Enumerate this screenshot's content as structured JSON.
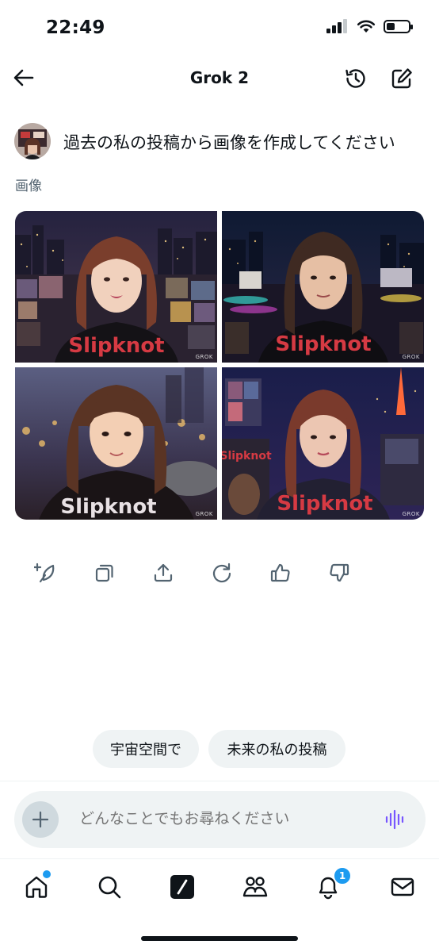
{
  "status_bar": {
    "time": "22:49",
    "battery_level": 0.4
  },
  "header": {
    "title": "Grok 2"
  },
  "conversation": {
    "prompt": "過去の私の投稿から画像を作成してください",
    "section_label": "画像",
    "images": [
      {
        "shirt_text": "Slipknot",
        "watermark": "GROK"
      },
      {
        "shirt_text": "Slipknot",
        "watermark": "GROK"
      },
      {
        "shirt_text": "Slipknot",
        "watermark": "GROK"
      },
      {
        "shirt_text": "Slipknot",
        "watermark": "GROK"
      }
    ]
  },
  "actions": [
    "add-to-post-icon",
    "copy-icon",
    "share-icon",
    "regenerate-icon",
    "thumbs-up-icon",
    "thumbs-down-icon"
  ],
  "suggestions": [
    "宇宙空間で",
    "未来の私の投稿"
  ],
  "input": {
    "placeholder": "どんなことでもお尋ねください"
  },
  "bottom_nav": {
    "items": [
      "home-icon",
      "search-icon",
      "grok-icon",
      "communities-icon",
      "notifications-icon",
      "messages-icon"
    ],
    "notifications_badge": "1"
  },
  "colors": {
    "accent": "#1d9bf0",
    "voice": "#7856ff",
    "muted_text": "#536471",
    "chip_bg": "#eff3f4"
  }
}
